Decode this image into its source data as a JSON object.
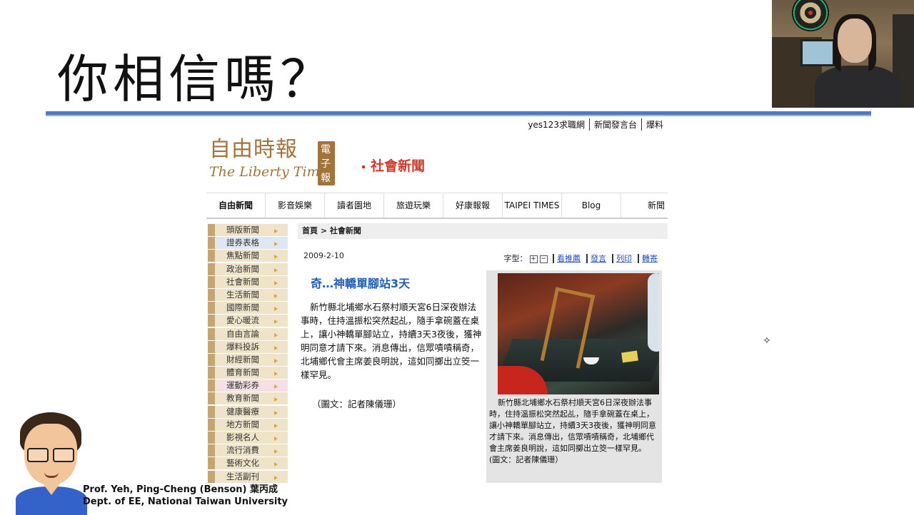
{
  "slide": {
    "title": "你相信嗎？",
    "presenter_line1": "Prof. Yeh, Ping-Cheng (Benson) 葉丙成",
    "presenter_line2": "Dept. of EE,  National  Taiwan University"
  },
  "webpage": {
    "top_links": [
      "yes123求職網",
      "新聞發言台",
      "爆料"
    ],
    "logo_cn": "自由時報",
    "logo_badge": "電子報",
    "logo_en": "The Liberty Times",
    "section_title": "社會新聞",
    "nav": [
      "自由新聞",
      "影音娛樂",
      "讀者園地",
      "旅遊玩樂",
      "好康報報",
      "TAIPEI TIMES",
      "Blog",
      "新聞"
    ],
    "sidebar": [
      "頭版新聞",
      "證券表格",
      "焦點新聞",
      "政治新聞",
      "社會新聞",
      "生活新聞",
      "國際新聞",
      "愛心暖流",
      "自由言論",
      "爆料投訴",
      "財經新聞",
      "體育新聞",
      "運動彩券",
      "教育新聞",
      "健康醫療",
      "地方新聞",
      "影視名人",
      "流行消費",
      "藝術文化",
      "生活副刊"
    ],
    "breadcrumb": "首頁 > 社會新聞",
    "date": "2009-2-10",
    "font_label": "字型：",
    "tools": [
      "看推薦",
      "發言",
      "列印",
      "轉寄"
    ],
    "headline": "奇…神轎單腳站3天",
    "body": "新竹縣北埔鄉水石祭村順天宮6日深夜辦法事時，住持溫振松突然起乩，隨手拿碗蓋在桌上，讓小神轎單腳站立，持續3天3夜後，獲神明同意才請下來。消息傳出，信眾嘖嘖稱奇，北埔鄉代會主席姜良明說，這如同擲出立筊一樣罕見。",
    "credit": "（圖文：記者陳儀珊）",
    "caption": "新竹縣北埔鄉水石祭村順天宮6日深夜辦法事時，住持溫振松突然起乩，隨手拿碗蓋在桌上，讓小神轎單腳站立，持續3天3夜後，獲神明同意才請下來。消息傳出，信眾嘖嘖稱奇，北埔鄉代會主席姜良明說，這如同擲出立筊一樣罕見。",
    "caption_credit": "(圖文：記者陳儀珊）"
  },
  "colors": {
    "title_rule": "#4f7bbd",
    "logo": "#a2733a",
    "section": "#d03a2c",
    "headline": "#1f5fb8",
    "link": "#1f4fb8"
  }
}
